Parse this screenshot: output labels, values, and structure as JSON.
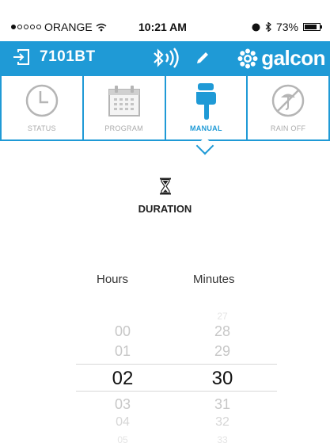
{
  "status_bar": {
    "carrier": "ORANGE",
    "time": "10:21 AM",
    "battery": "73%"
  },
  "app_bar": {
    "device_name": "7101BT",
    "brand": "galcon",
    "icons": [
      "device-back-icon",
      "bluetooth-signal-icon",
      "edit-pencil-icon",
      "galcon-logo-icon"
    ]
  },
  "tabs": [
    {
      "label": "STATUS",
      "icon": "clock-icon",
      "active": false
    },
    {
      "label": "PROGRAM",
      "icon": "calendar-icon",
      "active": false
    },
    {
      "label": "MANUAL",
      "icon": "hand-pointer-icon",
      "active": true
    },
    {
      "label": "RAIN OFF",
      "icon": "rain-off-icon",
      "active": false
    }
  ],
  "duration": {
    "label": "DURATION",
    "icon": "hourglass-icon"
  },
  "picker": {
    "hours_label": "Hours",
    "minutes_label": "Minutes",
    "hours": [
      "00",
      "01",
      "02",
      "03",
      "04",
      "05"
    ],
    "minutes": [
      "27",
      "28",
      "29",
      "30",
      "31",
      "32",
      "33"
    ],
    "selected_hours": "02",
    "selected_minutes": "30"
  },
  "colors": {
    "accent": "#1f9ad6",
    "tab_inactive": "#aaaaaa"
  }
}
